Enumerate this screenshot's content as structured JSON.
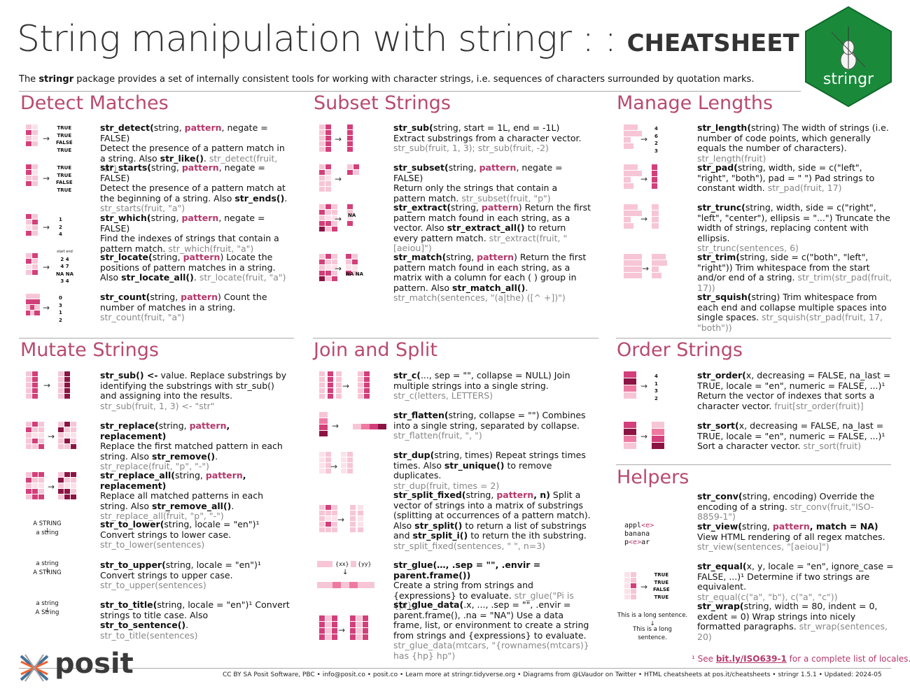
{
  "header": {
    "title_main": "String manipulation with stringr : :",
    "title_bold": "CHEATSHEET",
    "intro_pre": "The ",
    "intro_pkg": "stringr",
    "intro_post": " package provides a set of internally consistent tools for working with character strings, i.e. sequences of characters surrounded by quotation marks.",
    "logo_text": "stringr"
  },
  "sections": {
    "detect": "Detect Matches",
    "subset": "Subset Strings",
    "lengths": "Manage Lengths",
    "mutate": "Mutate Strings",
    "join": "Join and Split",
    "order": "Order Strings",
    "helpers": "Helpers"
  },
  "detect": [
    {
      "fn": "str_detect(",
      "args": "string, ",
      "pat": "pattern",
      "rest": ", negate = FALSE)",
      "desc": "Detect the presence of a pattern match in a string. Also ",
      "b2": "str_like()",
      ".": ".",
      "ex": " str_detect(fruit, \"a\")",
      "vals": [
        "TRUE",
        "TRUE",
        "FALSE",
        "TRUE"
      ]
    },
    {
      "fn": "str_starts(",
      "args": "string, ",
      "pat": "pattern",
      "rest": ", negate = FALSE)",
      "desc": "Detect the presence of a pattern match at the beginning of a string. Also ",
      "b2": "str_ends()",
      "ex": "str_starts(fruit, \"a\")",
      "vals": [
        "TRUE",
        "TRUE",
        "FALSE",
        "TRUE"
      ]
    },
    {
      "fn": "str_which(",
      "args": "string, ",
      "pat": "pattern",
      "rest": ", negate = FALSE)",
      "desc": "Find the indexes of strings that contain a pattern match.",
      "ex": " str_which(fruit, \"a\")",
      "vals": [
        "1",
        "2",
        "4"
      ]
    },
    {
      "fn": "str_locate(",
      "args": "string, ",
      "pat": "pattern",
      "rest": ")",
      "desc2": " Locate the positions of pattern matches in a string. Also ",
      "b2": "str_locate_all()",
      "ex": " str_locate(fruit, \"a\")",
      "vals": [
        "start  end",
        "2    4",
        "4    7",
        "NA NA",
        "3    4"
      ]
    },
    {
      "fn": "str_count(",
      "args": "string, ",
      "pat": "pattern",
      "rest": ")",
      "desc2": " Count the number of matches in a string.",
      "ex": " str_count(fruit, \"a\")",
      "vals": [
        "0",
        "3",
        "1",
        "2"
      ]
    }
  ],
  "subset": [
    {
      "fn": "str_sub(",
      "args": "string, start = 1L, end = -1L)",
      "desc2": " Extract substrings from a character vector.",
      "ex": "str_sub(fruit, 1, 3); str_sub(fruit, -2)"
    },
    {
      "fn": "str_subset(",
      "args": "string, ",
      "pat": "pattern",
      "rest": ", negate = FALSE)",
      "desc": "Return only the strings that contain a pattern match.",
      "ex": " str_subset(fruit, \"p\")"
    },
    {
      "fn": "str_extract(",
      "args": "string, ",
      "pat": "pattern",
      "rest": ")",
      "desc2": " Return the first pattern match found in each string, as a vector. Also ",
      "b2": "str_extract_all()",
      "desc3": " to return every pattern match.",
      "ex": " str_extract(fruit, \"[aeiou]\")",
      "vals": [
        "NA"
      ]
    },
    {
      "fn": "str_match(",
      "args": "string, ",
      "pat": "pattern",
      "rest": ")",
      "desc2": " Return the first pattern match found in each string, as a matrix with a column for each ( ) group in pattern. Also ",
      "b2": "str_match_all()",
      "ex": "str_match(sentences, \"(a|the) ([^ +])\")",
      "vals": [
        "NA NA"
      ]
    }
  ],
  "lengths": [
    {
      "fn": "str_length(",
      "args": "string)",
      "desc2": " The width of strings (i.e. number of code points, which generally equals the number of characters).",
      "ex": " str_length(fruit)",
      "vals": [
        "4",
        "6",
        "2",
        "3"
      ]
    },
    {
      "fn": "str_pad(",
      "args": "string, width, side = c(\"left\", \"right\", \"both\"), pad = \" \")",
      "desc2": " Pad strings to constant width.",
      "ex": " str_pad(fruit, 17)"
    },
    {
      "fn": "str_trunc(",
      "args": "string, width, side = c(\"right\", \"left\", \"center\"), ellipsis = \"...\")",
      "desc2": " Truncate the width of strings, replacing content with ellipsis.",
      "ex": "str_trunc(sentences, 6)"
    },
    {
      "fn": "str_trim(",
      "args": "string, side = c(\"both\", \"left\", \"right\"))",
      "desc2": " Trim whitespace from the start and/or end of a string.",
      "ex": " str_trim(str_pad(fruit, 17))"
    },
    {
      "fn": "str_squish(",
      "args": "string)",
      "desc2": " Trim whitespace from each end and collapse multiple spaces into single spaces.",
      "ex": " str_squish(str_pad(fruit, 17, \"both\"))"
    }
  ],
  "mutate": [
    {
      "fn": "str_sub() <-",
      "args": " value. Replace substrings by identifying the substrings with str_sub() and assigning into the results.",
      "ex": "str_sub(fruit, 1, 3) <- \"str\""
    },
    {
      "fn": "str_replace(",
      "args": "string, ",
      "pat": "pattern",
      "rest": ", replacement)",
      "desc": "Replace the first matched pattern in each string. Also ",
      "b2": "str_remove()",
      "ex": "str_replace(fruit, \"p\", \"-\")"
    },
    {
      "fn": "str_replace_all(",
      "args": "string, ",
      "pat": "pattern",
      "rest": ", replacement)",
      "desc": "Replace all matched patterns in each string. Also ",
      "b2": "str_remove_all()",
      "ex": "str_replace_all(fruit, \"p\", \"-\")"
    },
    {
      "fn": "str_to_lower(",
      "args": "string, locale = \"en\")¹",
      "desc": "Convert strings to lower case.",
      "ex": "str_to_lower(sentences)",
      "d1": "A STRING",
      "d2": "a string"
    },
    {
      "fn": "str_to_upper(",
      "args": "string, locale = \"en\")¹",
      "desc": "Convert strings to upper case.",
      "ex": "str_to_upper(sentences)",
      "d1": "a string",
      "d2": "A STRING"
    },
    {
      "fn": "str_to_title(",
      "args": "string, locale = \"en\")¹",
      "desc2": " Convert strings to title case. Also ",
      "b2": "str_to_sentence()",
      "ex": "str_to_title(sentences)",
      "d1": "a string",
      "d2": "A String"
    }
  ],
  "join": [
    {
      "fn": "str_c(",
      "args": "..., sep = \"\", collapse = NULL)",
      "desc2": " Join multiple strings into a single string.",
      "ex": "str_c(letters, LETTERS)"
    },
    {
      "fn": "str_flatten(",
      "args": "string, collapse = \"\")",
      "desc2": " Combines into a single string, separated by collapse.",
      "ex": "str_flatten(fruit, \", \")"
    },
    {
      "fn": "str_dup(",
      "args": "string, times)",
      "desc2": " Repeat strings times times. Also ",
      "b2": "str_unique()",
      "desc3": " to remove duplicates.",
      "ex": "str_dup(fruit, times = 2)"
    },
    {
      "fn": "str_split_fixed(",
      "args": "string, ",
      "pat": "pattern",
      "rest": ", n)",
      "desc2": " Split a vector of strings into a matrix of substrings (splitting at occurrences of a pattern match). Also ",
      "b2": "str_split()",
      "desc3": " to return a list of substrings and ",
      "b3": "str_split_i()",
      "desc4": " to return the ith substring.",
      "ex": "str_split_fixed(sentences, \" \", n=3)"
    },
    {
      "fn": "str_glue(",
      "args": "…, .sep = \"\", .envir = parent.frame())",
      "desc": "Create a string from strings and {expressions} to evaluate.",
      "ex": " str_glue(\"Pi is {pi}\")",
      "d1": "{xx}",
      "d2": "{yy}"
    },
    {
      "fn": "str_glue_data(",
      "args": ".x, ..., .sep = \"\", .envir = parent.frame(), .na = \"NA\")",
      "desc2": " Use a data frame, list, or environment to create a string from strings and {expressions} to evaluate.",
      "ex": "str_glue_data(mtcars, \"{rownames(mtcars)} has {hp} hp\")"
    }
  ],
  "order": [
    {
      "fn": "str_order(",
      "args": "x, decreasing = FALSE, na_last = TRUE, locale = \"en\", numeric = FALSE, ...)¹",
      "desc": "Return the vector of indexes that sorts a character vector.",
      "ex": " fruit[str_order(fruit)]",
      "vals": [
        "4",
        "1",
        "3",
        "2"
      ]
    },
    {
      "fn": "str_sort(",
      "args": "x, decreasing = FALSE, na_last = TRUE, locale = \"en\", numeric = FALSE, ...)¹",
      "desc": "Sort a character vector.",
      "ex": " str_sort(fruit)"
    }
  ],
  "helpers": [
    {
      "fn": "str_conv(",
      "args": "string, encoding)",
      "desc2": " Override the encoding of a string.",
      "ex": " str_conv(fruit,\"ISO-8859-1\")"
    },
    {
      "fn": "str_view(",
      "args": "string, ",
      "pat": "pattern",
      "rest": ", match = NA)",
      "desc": "View HTML rendering of all regex matches.",
      "ex": "str_view(sentences, \"[aeiou]\")",
      "d1": "appl<e>",
      "d2": "banana",
      "d3": "p<e>ar"
    },
    {
      "fn": "str_equal(",
      "args": "x, y, locale = \"en\", ignore_case = FALSE, ...)¹",
      "desc2": " Determine if two strings are equivalent.",
      "ex": " str_equal(c(\"a\", \"b\"), c(\"a\", \"c\"))",
      "vals": [
        "TRUE",
        "TRUE",
        "FALSE",
        "TRUE"
      ]
    },
    {
      "fn": "str_wrap(",
      "args": "string, width = 80, indent = 0, exdent = 0)",
      "desc2": " Wrap strings into nicely formatted paragraphs.",
      "ex": " str_wrap(sentences, 20)",
      "d1": "This is a long sentence.",
      "d2": "This is a long",
      "d3": "sentence."
    }
  ],
  "footer": {
    "posit": "posit",
    "note_pre": "¹ See ",
    "note_link": "bit.ly/ISO639-1",
    "note_post": " for a complete list of locales.",
    "credits": "CC BY SA Posit Software, PBC  •  info@posit.co  •  posit.co  •  Learn more at stringr.tidyverse.org  •  Diagrams from @LVaudor on Twitter  •  HTML cheatsheets at pos.it/cheatsheets  •  stringr 1.5.1  •  Updated:  2024-05"
  },
  "colors": {
    "accent": "#b84a70",
    "logo": "#1a8a3a",
    "pink_light": "#f7c6d6",
    "pink_mid": "#ee7aa3",
    "pink_dark": "#8c1444"
  }
}
